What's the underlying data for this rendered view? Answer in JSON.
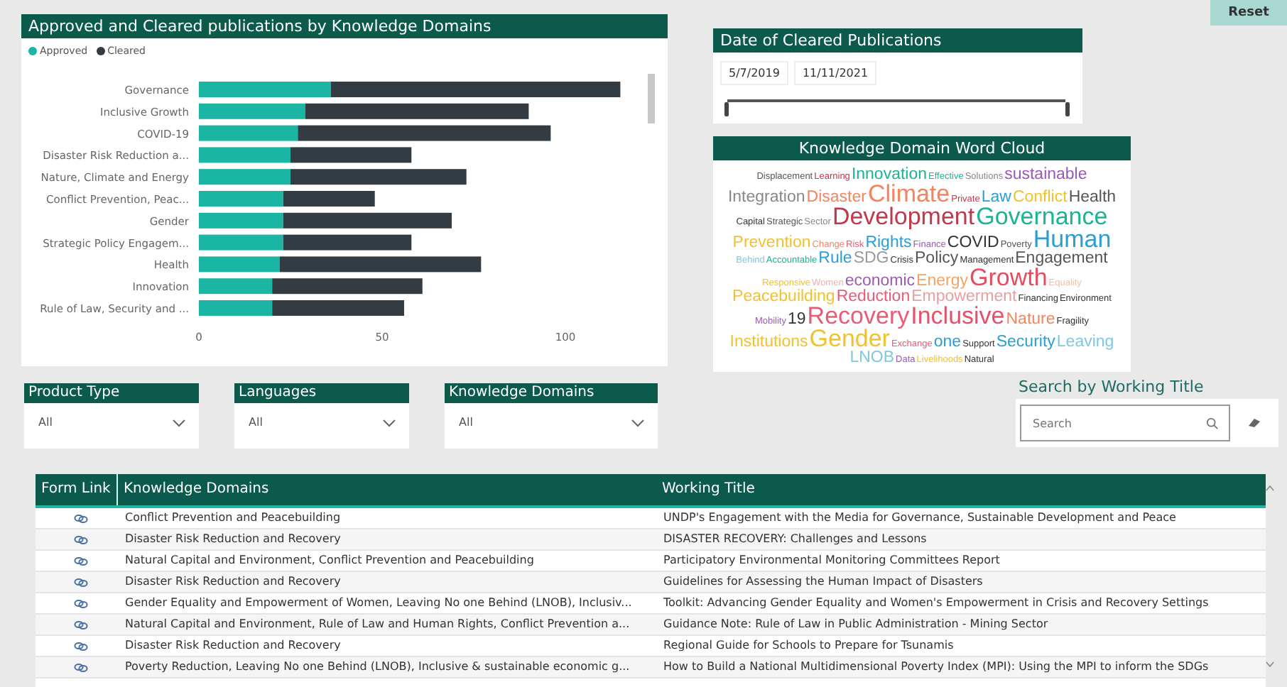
{
  "reset_button": {
    "label": "Reset"
  },
  "chart_panel": {
    "title": "Approved and Cleared publications by Knowledge Domains",
    "chart_data": {
      "type": "bar",
      "orientation": "horizontal",
      "stacked": true,
      "categories": [
        "Governance",
        "Inclusive Growth",
        "COVID-19",
        "Disaster Risk Reduction a...",
        "Nature, Climate and Energy",
        "Conflict Prevention, Peac...",
        "Gender",
        "Strategic Policy Engagem...",
        "Health",
        "Innovation",
        "Rule of Law, Security and ..."
      ],
      "series": [
        {
          "name": "Approved",
          "color": "#1ab5a3",
          "values": [
            36,
            29,
            27,
            25,
            25,
            23,
            23,
            23,
            22,
            20,
            20
          ]
        },
        {
          "name": "Cleared",
          "color": "#333c42",
          "values": [
            79,
            61,
            69,
            33,
            48,
            25,
            46,
            35,
            55,
            41,
            36
          ]
        }
      ],
      "xlim": [
        0,
        125
      ],
      "xticks": [
        0,
        50,
        100
      ]
    }
  },
  "date_panel": {
    "title": "Date of Cleared Publications",
    "start": "5/7/2019",
    "end": "11/11/2021",
    "handles": [
      {
        "level": 0
      },
      {
        "level": 1
      }
    ]
  },
  "word_cloud": {
    "title": "Knowledge Domain Word Cloud",
    "words": [
      {
        "text": "Displacement",
        "kind": "small",
        "color": "#555555"
      },
      {
        "text": "Learning",
        "kind": "small",
        "color": "#c0394b"
      },
      {
        "text": "Innovation",
        "kind": "mid",
        "color": "#1bb394"
      },
      {
        "text": "Effective",
        "kind": "small",
        "color": "#1bb394"
      },
      {
        "text": "Solutions",
        "kind": "small",
        "color": "#888888"
      },
      {
        "text": "sustainable",
        "kind": "mid",
        "color": "#9b59b6"
      },
      {
        "text": "Integration",
        "kind": "mid",
        "color": "#888888"
      },
      {
        "text": "Disaster",
        "kind": "mid",
        "color": "#f4845f"
      },
      {
        "text": "Climate",
        "kind": "big",
        "color": "#f4845f"
      },
      {
        "text": "Private",
        "kind": "small",
        "color": "#c0394b"
      },
      {
        "text": "Law",
        "kind": "mid",
        "color": "#2a9fd6"
      },
      {
        "text": "Conflict",
        "kind": "mid",
        "color": "#f2c12e"
      },
      {
        "text": "Health",
        "kind": "mid",
        "color": "#555555"
      },
      {
        "text": "Capital",
        "kind": "small",
        "color": "#333333"
      },
      {
        "text": "Strategic",
        "kind": "small",
        "color": "#555555"
      },
      {
        "text": "Sector",
        "kind": "small",
        "color": "#888888"
      },
      {
        "text": "Development",
        "kind": "big",
        "color": "#c0394b"
      },
      {
        "text": "Governance",
        "kind": "big",
        "color": "#1bb394"
      },
      {
        "text": "Prevention",
        "kind": "mid",
        "color": "#f2c12e"
      },
      {
        "text": "Change",
        "kind": "small",
        "color": "#f4845f"
      },
      {
        "text": "Risk",
        "kind": "small",
        "color": "#e85d75"
      },
      {
        "text": "Rights",
        "kind": "mid",
        "color": "#2a9fd6"
      },
      {
        "text": "Finance",
        "kind": "small",
        "color": "#9b59b6"
      },
      {
        "text": "COVID",
        "kind": "mid",
        "color": "#333333"
      },
      {
        "text": "Poverty",
        "kind": "small",
        "color": "#555555"
      },
      {
        "text": "Human",
        "kind": "big",
        "color": "#2a9fd6"
      },
      {
        "text": "Behind",
        "kind": "small",
        "color": "#7ec8e3"
      },
      {
        "text": "Accountable",
        "kind": "small",
        "color": "#1bb394"
      },
      {
        "text": "Rule",
        "kind": "mid",
        "color": "#2a9fd6"
      },
      {
        "text": "SDG",
        "kind": "mid",
        "color": "#9a9a9a"
      },
      {
        "text": "Crisis",
        "kind": "small",
        "color": "#333333"
      },
      {
        "text": "Policy",
        "kind": "mid",
        "color": "#555555"
      },
      {
        "text": "Management",
        "kind": "small",
        "color": "#333333"
      },
      {
        "text": "Engagement",
        "kind": "mid",
        "color": "#555555"
      },
      {
        "text": "Responsive",
        "kind": "small",
        "color": "#f2c12e"
      },
      {
        "text": "Women",
        "kind": "small",
        "color": "#f0b0b0"
      },
      {
        "text": "economic",
        "kind": "mid",
        "color": "#9b59b6"
      },
      {
        "text": "Energy",
        "kind": "mid",
        "color": "#f4a35f"
      },
      {
        "text": "Growth",
        "kind": "big",
        "color": "#e84a5f"
      },
      {
        "text": "Equality",
        "kind": "small",
        "color": "#f0c0a0"
      },
      {
        "text": "Peacebuilding",
        "kind": "mid",
        "color": "#f2c12e"
      },
      {
        "text": "Reduction",
        "kind": "mid",
        "color": "#e85d75"
      },
      {
        "text": "Empowerment",
        "kind": "mid",
        "color": "#e8a0a0"
      },
      {
        "text": "Financing",
        "kind": "small",
        "color": "#333333"
      },
      {
        "text": "Environment",
        "kind": "small",
        "color": "#333333"
      },
      {
        "text": "Mobility",
        "kind": "small",
        "color": "#9b59b6"
      },
      {
        "text": "19",
        "kind": "mid",
        "color": "#333333"
      },
      {
        "text": "Recovery",
        "kind": "big",
        "color": "#e85d75"
      },
      {
        "text": "Inclusive",
        "kind": "big",
        "color": "#e8506a"
      },
      {
        "text": "Nature",
        "kind": "mid",
        "color": "#f4845f"
      },
      {
        "text": "Fragility",
        "kind": "small",
        "color": "#333333"
      },
      {
        "text": "Institutions",
        "kind": "mid",
        "color": "#f2c12e"
      },
      {
        "text": "Gender",
        "kind": "big",
        "color": "#f2c12e"
      },
      {
        "text": "Exchange",
        "kind": "small",
        "color": "#e85d75"
      },
      {
        "text": "one",
        "kind": "mid",
        "color": "#2a9fd6"
      },
      {
        "text": "Support",
        "kind": "small",
        "color": "#333333"
      },
      {
        "text": "Security",
        "kind": "mid",
        "color": "#2a9fd6"
      },
      {
        "text": "Leaving",
        "kind": "mid",
        "color": "#7ec8e3"
      },
      {
        "text": "LNOB",
        "kind": "mid",
        "color": "#7ec8e3"
      },
      {
        "text": "Data",
        "kind": "small",
        "color": "#9b59b6"
      },
      {
        "text": "Livelihoods",
        "kind": "small",
        "color": "#f2c12e"
      },
      {
        "text": "Natural",
        "kind": "small",
        "color": "#333333"
      }
    ]
  },
  "filters": [
    {
      "title": "Product Type",
      "value": "All"
    },
    {
      "title": "Languages",
      "value": "All"
    },
    {
      "title": "Knowledge Domains",
      "value": "All"
    }
  ],
  "search": {
    "title": "Search by Working Title",
    "placeholder": "Search"
  },
  "table": {
    "columns": [
      "Form Link",
      "Knowledge Domains",
      "Working Title"
    ],
    "rows": [
      {
        "domains": "Conflict Prevention and Peacebuilding",
        "title": "UNDP's Engagement with the Media for Governance, Sustainable Development and Peace"
      },
      {
        "domains": "Disaster Risk Reduction and Recovery",
        "title": "DISASTER RECOVERY: Challenges and Lessons"
      },
      {
        "domains": "Natural Capital and Environment, Conflict Prevention and Peacebuilding",
        "title": "Participatory Environmental Monitoring Committees Report"
      },
      {
        "domains": "Disaster Risk Reduction and Recovery",
        "title": "Guidelines for Assessing the Human Impact of Disasters"
      },
      {
        "domains": "Gender Equality and Empowerment of Women, Leaving No one Behind (LNOB), Inclusiv...",
        "title": "Toolkit: Advancing Gender Equality and Women's Empowerment in Crisis and Recovery Settings"
      },
      {
        "domains": "Natural Capital and Environment, Rule of Law and Human Rights, Conflict Prevention a...",
        "title": "Guidance Note: Rule of Law in Public Administration - Mining Sector"
      },
      {
        "domains": "Disaster Risk Reduction and Recovery",
        "title": "Regional Guide for Schools to Prepare for Tsunamis"
      },
      {
        "domains": "Poverty Reduction, Leaving No one Behind (LNOB), Inclusive & sustainable economic g...",
        "title": "How to Build a National Multidimensional Poverty Index (MPI): Using the MPI to inform the SDGs"
      }
    ]
  }
}
